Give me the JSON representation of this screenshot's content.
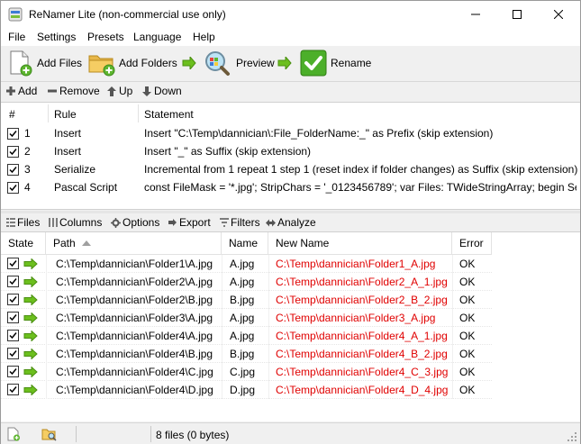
{
  "window": {
    "title": "ReNamer Lite (non-commercial use only)"
  },
  "menu": [
    "File",
    "Settings",
    "Presets",
    "Language",
    "Help"
  ],
  "toolbar": {
    "add_files": "Add Files",
    "add_folders": "Add Folders",
    "preview": "Preview",
    "rename": "Rename"
  },
  "rules_toolbar": {
    "add": "Add",
    "remove": "Remove",
    "up": "Up",
    "down": "Down"
  },
  "rules": {
    "headers": {
      "num": "#",
      "rule": "Rule",
      "statement": "Statement"
    },
    "rows": [
      {
        "checked": true,
        "num": "1",
        "rule": "Insert",
        "statement": "Insert \"C:\\Temp\\dannician\\:File_FolderName:_\" as Prefix (skip extension)"
      },
      {
        "checked": true,
        "num": "2",
        "rule": "Insert",
        "statement": "Insert \"_\" as Suffix (skip extension)"
      },
      {
        "checked": true,
        "num": "3",
        "rule": "Serialize",
        "statement": "Incremental from 1 repeat 1 step 1 (reset index if folder changes) as Suffix (skip extension)"
      },
      {
        "checked": true,
        "num": "4",
        "rule": "Pascal Script",
        "statement": "const FileMask = '*.jpg'; StripChars = '_0123456789'; var Files: TWideStringArray; begin Se..."
      }
    ]
  },
  "files_toolbar": {
    "files": "Files",
    "columns": "Columns",
    "options": "Options",
    "export": "Export",
    "filters": "Filters",
    "analyze": "Analyze"
  },
  "files": {
    "headers": {
      "state": "State",
      "path": "Path",
      "name": "Name",
      "new_name": "New Name",
      "error": "Error"
    },
    "rows": [
      {
        "path": "C:\\Temp\\dannician\\Folder1\\A.jpg",
        "name": "A.jpg",
        "new_name": "C:\\Temp\\dannician\\Folder1_A.jpg",
        "error": "OK"
      },
      {
        "path": "C:\\Temp\\dannician\\Folder2\\A.jpg",
        "name": "A.jpg",
        "new_name": "C:\\Temp\\dannician\\Folder2_A_1.jpg",
        "error": "OK"
      },
      {
        "path": "C:\\Temp\\dannician\\Folder2\\B.jpg",
        "name": "B.jpg",
        "new_name": "C:\\Temp\\dannician\\Folder2_B_2.jpg",
        "error": "OK"
      },
      {
        "path": "C:\\Temp\\dannician\\Folder3\\A.jpg",
        "name": "A.jpg",
        "new_name": "C:\\Temp\\dannician\\Folder3_A.jpg",
        "error": "OK"
      },
      {
        "path": "C:\\Temp\\dannician\\Folder4\\A.jpg",
        "name": "A.jpg",
        "new_name": "C:\\Temp\\dannician\\Folder4_A_1.jpg",
        "error": "OK"
      },
      {
        "path": "C:\\Temp\\dannician\\Folder4\\B.jpg",
        "name": "B.jpg",
        "new_name": "C:\\Temp\\dannician\\Folder4_B_2.jpg",
        "error": "OK"
      },
      {
        "path": "C:\\Temp\\dannician\\Folder4\\C.jpg",
        "name": "C.jpg",
        "new_name": "C:\\Temp\\dannician\\Folder4_C_3.jpg",
        "error": "OK"
      },
      {
        "path": "C:\\Temp\\dannician\\Folder4\\D.jpg",
        "name": "D.jpg",
        "new_name": "C:\\Temp\\dannician\\Folder4_D_4.jpg",
        "error": "OK"
      }
    ]
  },
  "status": {
    "text": "8 files (0 bytes)"
  },
  "colors": {
    "new_name": "#e00000",
    "arrow": "#6cbf1e",
    "rename_icon": "#4caf2a"
  },
  "icons": {
    "app": "renamer-app-icon",
    "add_files": "add-file-icon",
    "add_folders": "add-folder-icon",
    "preview": "magnifier-icon",
    "rename": "checkmark-icon",
    "state": "green-arrow-icon"
  }
}
